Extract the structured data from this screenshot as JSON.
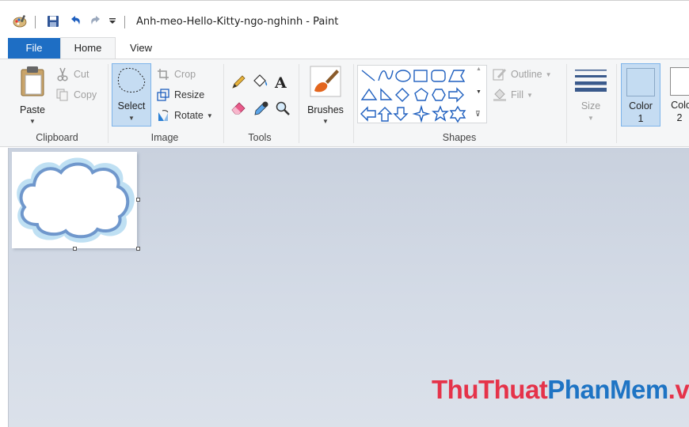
{
  "window": {
    "title": "Anh-meo-Hello-Kitty-ngo-nghinh - Paint"
  },
  "quick_access": {
    "customize_glyph": "⪨"
  },
  "tabs": [
    {
      "label": "File"
    },
    {
      "label": "Home"
    },
    {
      "label": "View"
    }
  ],
  "ribbon": {
    "clipboard": {
      "label": "Clipboard",
      "paste": "Paste",
      "cut": "Cut",
      "copy": "Copy"
    },
    "image": {
      "label": "Image",
      "select": "Select",
      "crop": "Crop",
      "resize": "Resize",
      "rotate": "Rotate"
    },
    "tools": {
      "label": "Tools"
    },
    "brushes": {
      "label": "Brushes"
    },
    "shapes": {
      "label": "Shapes",
      "outline": "Outline",
      "fill": "Fill"
    },
    "size": {
      "label": "Size"
    },
    "colors": {
      "color1": "Color",
      "color1_num": "1",
      "color2": "Colo",
      "color2_num": "2",
      "color1_value": "#c4dcf2",
      "color2_value": "#ffffff"
    }
  },
  "watermark": {
    "part1": "ThuThuat",
    "part2": "PhanMem",
    "part3": ".vn"
  },
  "colors": {
    "accent": "#1e6ec4",
    "selected_bg": "#c5dcf2",
    "workspace": "#d0d7e2"
  }
}
